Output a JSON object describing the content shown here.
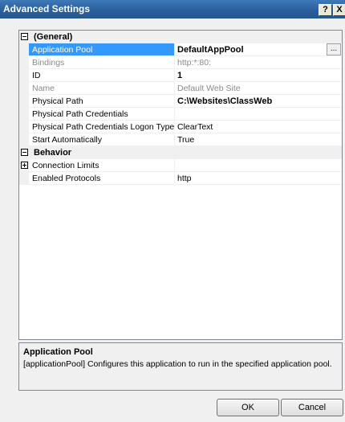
{
  "window": {
    "title": "Advanced Settings",
    "help_label": "?",
    "close_label": "X"
  },
  "categories": {
    "general": "(General)",
    "behavior": "Behavior"
  },
  "properties": {
    "general": [
      {
        "name": "Application Pool",
        "value": "DefaultAppPool"
      },
      {
        "name": "Bindings",
        "value": "http:*:80:"
      },
      {
        "name": "ID",
        "value": "1"
      },
      {
        "name": "Name",
        "value": "Default Web Site"
      },
      {
        "name": "Physical Path",
        "value": "C:\\Websites\\ClassWeb"
      },
      {
        "name": "Physical Path Credentials",
        "value": ""
      },
      {
        "name": "Physical Path Credentials Logon Type",
        "value": "ClearText"
      },
      {
        "name": "Start Automatically",
        "value": "True"
      }
    ],
    "behavior": [
      {
        "name": "Connection Limits",
        "value": ""
      },
      {
        "name": "Enabled Protocols",
        "value": "http"
      }
    ]
  },
  "ellipsis_label": "...",
  "description": {
    "title": "Application Pool",
    "text": "[applicationPool] Configures this application to run in the specified application pool."
  },
  "buttons": {
    "ok": "OK",
    "cancel": "Cancel"
  }
}
